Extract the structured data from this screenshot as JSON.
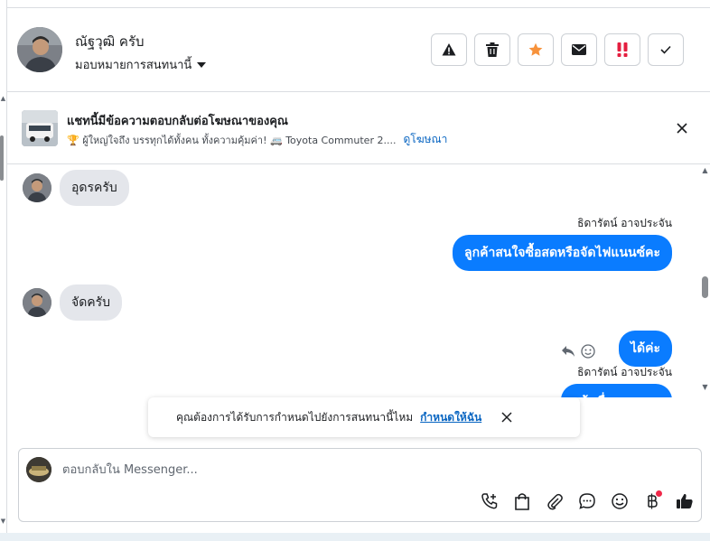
{
  "contact": {
    "name": "ณัฐวุฒิ ครับ",
    "assign_label": "มอบหมายการสนทนานี้"
  },
  "header_actions": [
    {
      "name": "report-button",
      "icon": "warning-icon"
    },
    {
      "name": "delete-button",
      "icon": "trash-icon"
    },
    {
      "name": "star-button",
      "icon": "star-icon"
    },
    {
      "name": "mark-unread-button",
      "icon": "envelope-icon"
    },
    {
      "name": "spam-button",
      "icon": "exclamation-icon"
    },
    {
      "name": "done-button",
      "icon": "check-icon"
    }
  ],
  "ad": {
    "title": "แชทนี้มีข้อความตอบกลับต่อโฆษณาของคุณ",
    "subtitle": "🏆 ผู้ใหญ่ใจถึง บรรทุกได้ทั้งคน ทั้งความคุ้มค่า! 🚐 Toyota Commuter 2....",
    "link": "ดูโฆษณา"
  },
  "messages": [
    {
      "direction": "in",
      "text": "อุดรครับ"
    },
    {
      "direction": "out",
      "sender": "ธิดารัตน์ อาจประจัน",
      "text": "ลูกค้าสนใจซื้อสดหรือจัดไฟแนนซ์คะ"
    },
    {
      "direction": "in",
      "text": "จัดครับ"
    },
    {
      "direction": "out",
      "text": "ได้ค่ะ"
    },
    {
      "direction": "out",
      "sender": "ธิดารัตน์ อาจประจัน",
      "text": "แจ้งเรื่องเอกสาร"
    }
  ],
  "toast": {
    "text": "คุณต้องการได้รับการกำหนดไปยังการสนทนานี้ไหม",
    "link": "กำหนดให้ฉัน"
  },
  "composer": {
    "placeholder": "ตอบกลับใน Messenger..."
  },
  "colors": {
    "accent": "#0a7cff",
    "link": "#0a66c2",
    "star": "#f7923b",
    "spam": "#e41e3f",
    "notification_dot": "#f02849"
  }
}
